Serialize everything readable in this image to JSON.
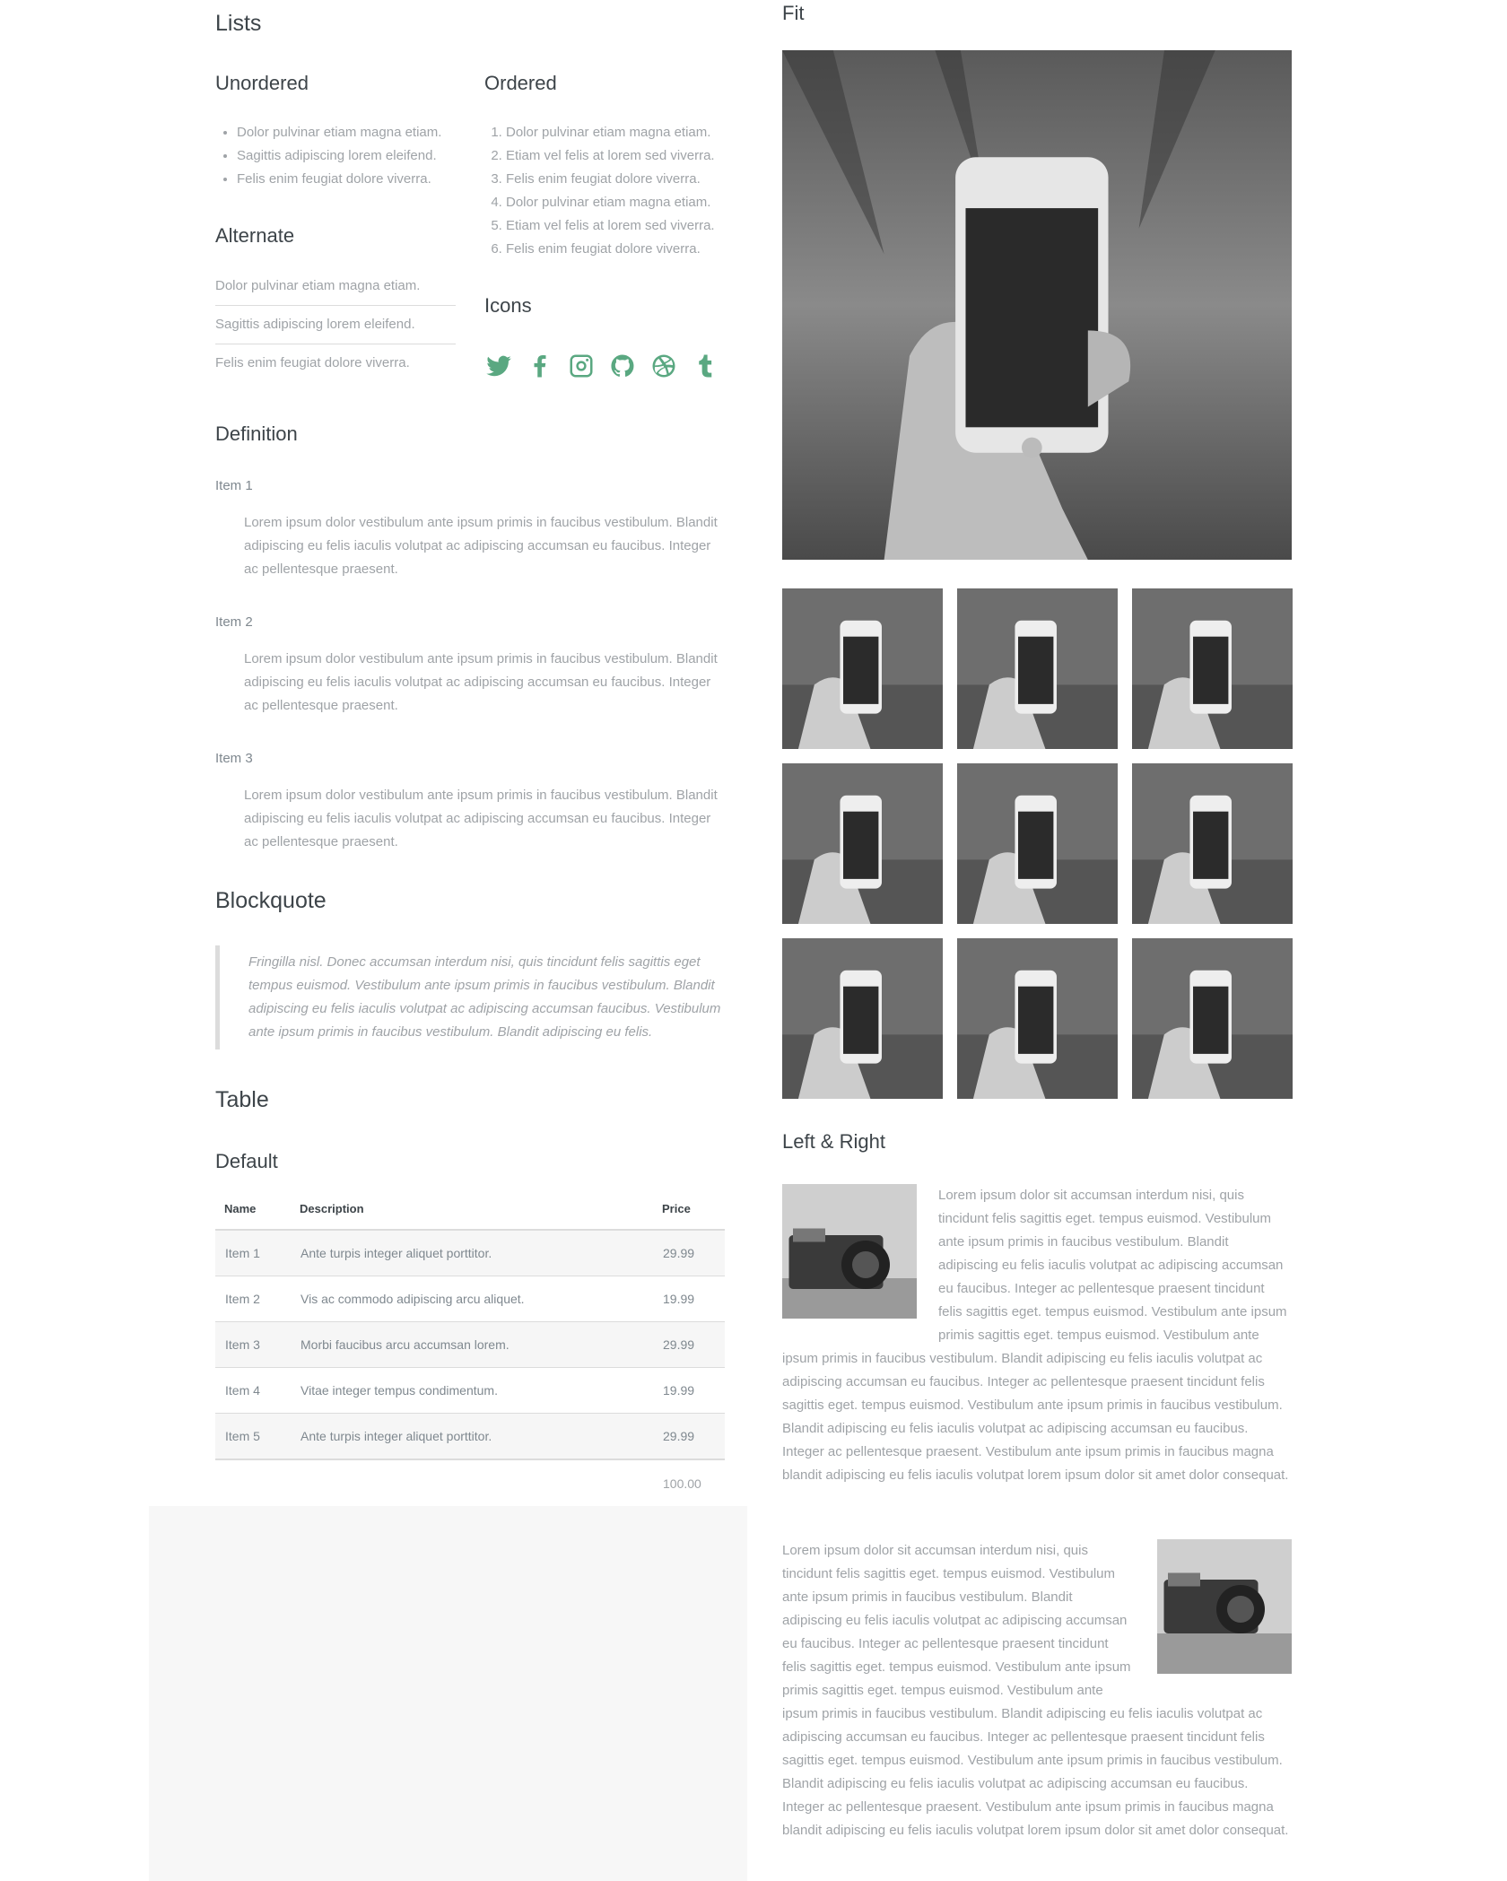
{
  "lists": {
    "title": "Lists",
    "unordered": {
      "title": "Unordered",
      "items": [
        "Dolor pulvinar etiam magna etiam.",
        "Sagittis adipiscing lorem eleifend.",
        "Felis enim feugiat dolore viverra."
      ]
    },
    "alternate": {
      "title": "Alternate",
      "items": [
        "Dolor pulvinar etiam magna etiam.",
        "Sagittis adipiscing lorem eleifend.",
        "Felis enim feugiat dolore viverra."
      ]
    },
    "ordered": {
      "title": "Ordered",
      "items": [
        "Dolor pulvinar etiam magna etiam.",
        "Etiam vel felis at lorem sed viverra.",
        "Felis enim feugiat dolore viverra.",
        "Dolor pulvinar etiam magna etiam.",
        "Etiam vel felis at lorem sed viverra.",
        "Felis enim feugiat dolore viverra."
      ]
    },
    "icons": {
      "title": "Icons",
      "items": [
        "twitter-icon",
        "facebook-icon",
        "instagram-icon",
        "github-icon",
        "dribbble-icon",
        "tumblr-icon"
      ],
      "color": "#5aa881"
    }
  },
  "definition": {
    "title": "Definition",
    "items": [
      {
        "term": "Item 1",
        "desc": "Lorem ipsum dolor vestibulum ante ipsum primis in faucibus vestibulum. Blandit adipiscing eu felis iaculis volutpat ac adipiscing accumsan eu faucibus. Integer ac pellentesque praesent."
      },
      {
        "term": "Item 2",
        "desc": "Lorem ipsum dolor vestibulum ante ipsum primis in faucibus vestibulum. Blandit adipiscing eu felis iaculis volutpat ac adipiscing accumsan eu faucibus. Integer ac pellentesque praesent."
      },
      {
        "term": "Item 3",
        "desc": "Lorem ipsum dolor vestibulum ante ipsum primis in faucibus vestibulum. Blandit adipiscing eu felis iaculis volutpat ac adipiscing accumsan eu faucibus. Integer ac pellentesque praesent."
      }
    ]
  },
  "blockquote": {
    "title": "Blockquote",
    "text": "Fringilla nisl. Donec accumsan interdum nisi, quis tincidunt felis sagittis eget tempus euismod. Vestibulum ante ipsum primis in faucibus vestibulum. Blandit adipiscing eu felis iaculis volutpat ac adipiscing accumsan faucibus. Vestibulum ante ipsum primis in faucibus vestibulum. Blandit adipiscing eu felis."
  },
  "table": {
    "title": "Table",
    "subtitle": "Default",
    "headers": [
      "Name",
      "Description",
      "Price"
    ],
    "rows": [
      [
        "Item 1",
        "Ante turpis integer aliquet porttitor.",
        "29.99"
      ],
      [
        "Item 2",
        "Vis ac commodo adipiscing arcu aliquet.",
        "19.99"
      ],
      [
        "Item 3",
        "Morbi faucibus arcu accumsan lorem.",
        "29.99"
      ],
      [
        "Item 4",
        "Vitae integer tempus condimentum.",
        "19.99"
      ],
      [
        "Item 5",
        "Ante turpis integer aliquet porttitor.",
        "29.99"
      ]
    ],
    "total": "100.00"
  },
  "images": {
    "fit_title": "Fit",
    "left_right_title": "Left & Right",
    "paragraph": "Lorem ipsum dolor sit accumsan interdum nisi, quis tincidunt felis sagittis eget. tempus euismod. Vestibulum ante ipsum primis in faucibus vestibulum. Blandit adipiscing eu felis iaculis volutpat ac adipiscing accumsan eu faucibus. Integer ac pellentesque praesent tincidunt felis sagittis eget. tempus euismod. Vestibulum ante ipsum primis sagittis eget. tempus euismod. Vestibulum ante ipsum primis in faucibus vestibulum. Blandit adipiscing eu felis iaculis volutpat ac adipiscing accumsan eu faucibus. Integer ac pellentesque praesent tincidunt felis sagittis eget. tempus euismod. Vestibulum ante ipsum primis in faucibus vestibulum. Blandit adipiscing eu felis iaculis volutpat ac adipiscing accumsan eu faucibus. Integer ac pellentesque praesent. Vestibulum ante ipsum primis in faucibus magna blandit adipiscing eu felis iaculis volutpat lorem ipsum dolor sit amet dolor consequat."
  }
}
